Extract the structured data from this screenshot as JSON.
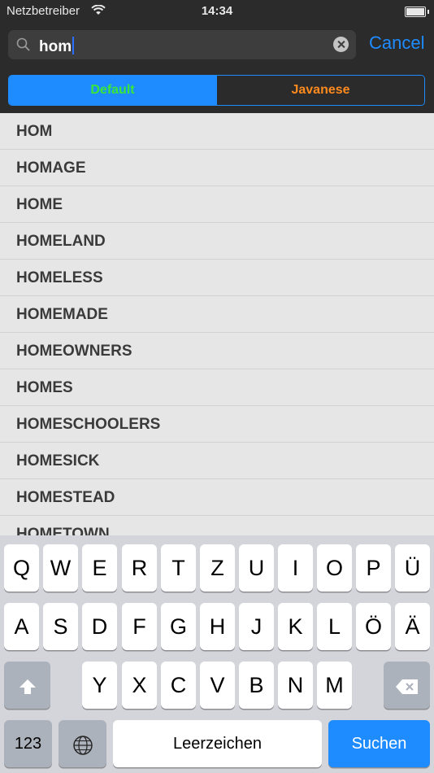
{
  "status_bar": {
    "carrier": "Netzbetreiber",
    "time": "14:34"
  },
  "search": {
    "query": "hom",
    "cancel_label": "Cancel"
  },
  "segments": [
    {
      "label": "Default",
      "selected": true
    },
    {
      "label": "Javanese",
      "selected": false
    }
  ],
  "results": [
    "HOM",
    "HOMAGE",
    "HOME",
    "HOMELAND",
    "HOMELESS",
    "HOMEMADE",
    "HOMEOWNERS",
    "HOMES",
    "HOMESCHOOLERS",
    "HOMESICK",
    "HOMESTEAD",
    "HOMETOWN"
  ],
  "keyboard": {
    "row1": [
      "Q",
      "W",
      "E",
      "R",
      "T",
      "Z",
      "U",
      "I",
      "O",
      "P",
      "Ü"
    ],
    "row2": [
      "A",
      "S",
      "D",
      "F",
      "G",
      "H",
      "J",
      "K",
      "L",
      "Ö",
      "Ä"
    ],
    "row3": [
      "Y",
      "X",
      "C",
      "V",
      "B",
      "N",
      "M"
    ],
    "numbers_label": "123",
    "space_label": "Leerzeichen",
    "return_label": "Suchen"
  },
  "colors": {
    "accent": "#1e8cff",
    "default_segment_text": "#39e639",
    "javanese_segment_text": "#ff8a1e"
  }
}
